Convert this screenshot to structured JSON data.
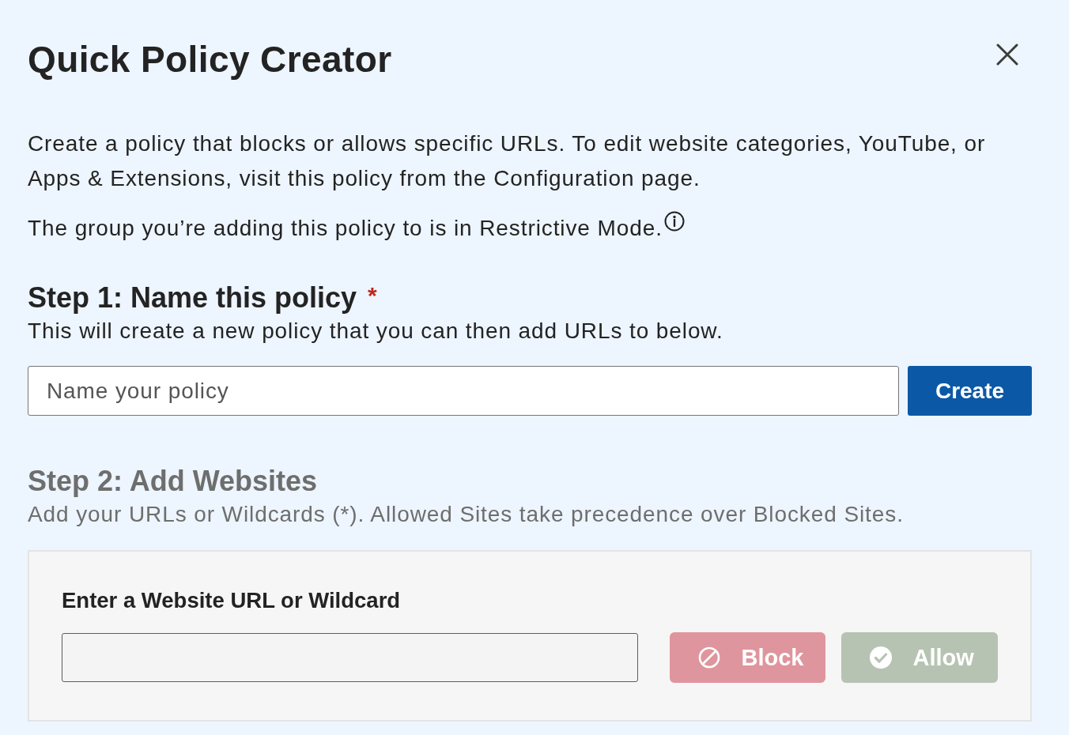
{
  "dialog": {
    "title": "Quick Policy Creator"
  },
  "intro": {
    "description": "Create a policy that blocks or allows specific URLs. To edit website categories, YouTube, or Apps & Extensions, visit this policy from the Configuration page.",
    "mode_note": "The group you’re adding this policy to is in Restrictive Mode."
  },
  "step1": {
    "heading": "Step 1: Name this policy",
    "required_mark": "*",
    "disabled": false,
    "hint": "This will create a new policy that you can then add URLs to below.",
    "name_field": {
      "placeholder": "Name your policy"
    },
    "button": {
      "label": "Create",
      "disabled": false
    }
  },
  "step2": {
    "heading": "Step 2: Add Websites",
    "disabled": true,
    "hint": "Add your URLs or Wildcards (*). Allowed Sites take precedence over Blocked Sites.",
    "url_field": {
      "label": "Enter a Website URL or Wildcard"
    },
    "buttons": [
      {
        "kind": "block",
        "label": "Block",
        "disabled": true
      },
      {
        "kind": "allow",
        "label": "Allow",
        "disabled": true
      }
    ]
  }
}
